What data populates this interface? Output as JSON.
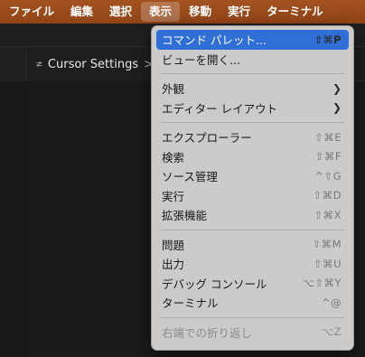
{
  "menubar": {
    "items": [
      "ファイル",
      "編集",
      "選択",
      "表示",
      "移動",
      "実行",
      "ターミナル"
    ],
    "active_index": 3
  },
  "tab": {
    "title": "Cursor Settings",
    "chevron": ">"
  },
  "view_menu": {
    "groups": [
      [
        {
          "label": "コマンド パレット...",
          "shortcut": "⇧⌘P",
          "highlighted": true
        },
        {
          "label": "ビューを開く...",
          "shortcut": ""
        }
      ],
      [
        {
          "label": "外観",
          "submenu": true
        },
        {
          "label": "エディター レイアウト",
          "submenu": true
        }
      ],
      [
        {
          "label": "エクスプローラー",
          "shortcut": "⇧⌘E"
        },
        {
          "label": "検索",
          "shortcut": "⇧⌘F"
        },
        {
          "label": "ソース管理",
          "shortcut": "^⇧G"
        },
        {
          "label": "実行",
          "shortcut": "⇧⌘D"
        },
        {
          "label": "拡張機能",
          "shortcut": "⇧⌘X"
        }
      ],
      [
        {
          "label": "問題",
          "shortcut": "⇧⌘M"
        },
        {
          "label": "出力",
          "shortcut": "⇧⌘U"
        },
        {
          "label": "デバッグ コンソール",
          "shortcut": "⌥⇧⌘Y"
        },
        {
          "label": "ターミナル",
          "shortcut": "^@"
        }
      ],
      [
        {
          "label": "右端での折り返し",
          "shortcut": "⌥Z",
          "disabled": true
        }
      ]
    ]
  },
  "colors": {
    "menubar": "#a3521f",
    "highlight": "#2f6fd7",
    "menu_bg": "#cdcbc9"
  }
}
